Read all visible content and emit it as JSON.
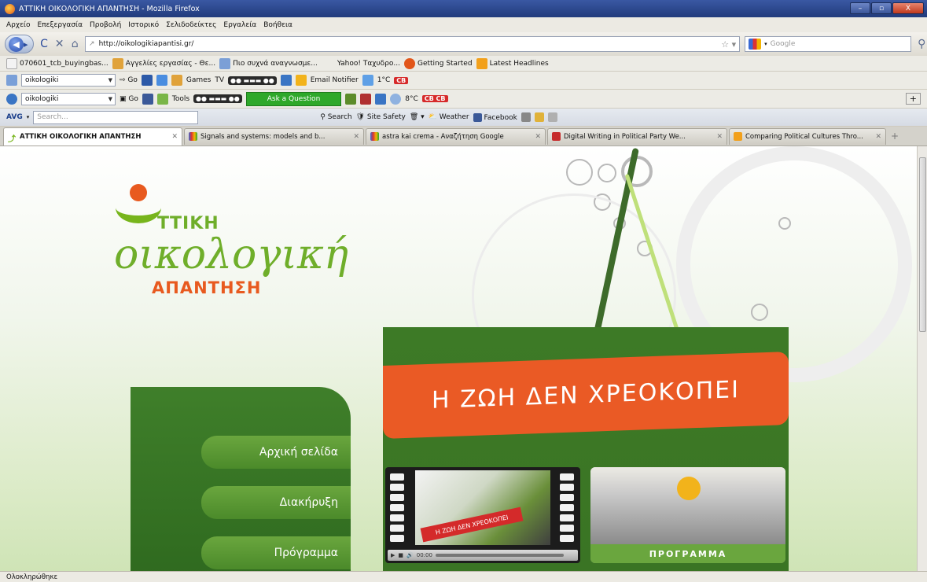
{
  "window": {
    "title": "ΑΤΤΙΚΗ ΟΙΚΟΛΟΓΙΚΗ ΑΠΑΝΤΗΣΗ - Mozilla Firefox",
    "min": "–",
    "max": "▫",
    "close": "X"
  },
  "menu": [
    "Αρχείο",
    "Επεξεργασία",
    "Προβολή",
    "Ιστορικό",
    "Σελιδοδείκτες",
    "Εργαλεία",
    "Βοήθεια"
  ],
  "nav": {
    "url": "http://oikologikiapantisi.gr/",
    "search_placeholder": "Google"
  },
  "bookmarks": [
    "070601_tcb_buyingbas...",
    "Αγγελίες εργασίας - Θε...",
    "Πιο συχνά αναγνωσμε...",
    "Yahoo! Ταχυδρο...",
    "Getting Started",
    "Latest Headlines"
  ],
  "toolbar1": {
    "combo": "oikologiki",
    "go": "Go",
    "games": "Games",
    "tv": "TV",
    "email": "Email Notifier",
    "temp": "1°C"
  },
  "toolbar2": {
    "combo": "oikologiki",
    "go": "Go",
    "tools": "Tools",
    "ask": "Ask a Question",
    "temp": "8°C"
  },
  "avgbar": {
    "brand": "AVG",
    "placeholder": "Search...",
    "search": "Search",
    "site_safety": "Site Safety",
    "weather": "Weather",
    "facebook": "Facebook"
  },
  "tabs": [
    {
      "label": "ΑΤΤΙΚΗ ΟΙΚΟΛΟΓΙΚΗ ΑΠΑΝΤΗΣΗ",
      "active": true
    },
    {
      "label": "Signals and systems: models and b..."
    },
    {
      "label": "astra kai crema - Αναζήτηση Google"
    },
    {
      "label": "Digital Writing in Political Party We..."
    },
    {
      "label": "Comparing Political Cultures Thro..."
    }
  ],
  "page": {
    "logo": {
      "line1": "ΤΤΙΚΗ",
      "line2": "οικολογική",
      "line3": "ΑΠΑΝΤΗΣΗ"
    },
    "slogan": "Η ΖΩΗ ΔΕΝ ΧΡΕΟΚΟΠΕΙ",
    "nav_items": [
      "Αρχική σελίδα",
      "Διακήρυξη",
      "Πρόγραμμα"
    ],
    "video_banner": "Η ΖΩΗ ΔΕΝ ΧΡΕΟΚΟΠΕΙ",
    "video_time": "00:00",
    "programme_label": "ΠΡΟΓΡΑΜΜΑ"
  },
  "status": "Ολοκληρώθηκε"
}
